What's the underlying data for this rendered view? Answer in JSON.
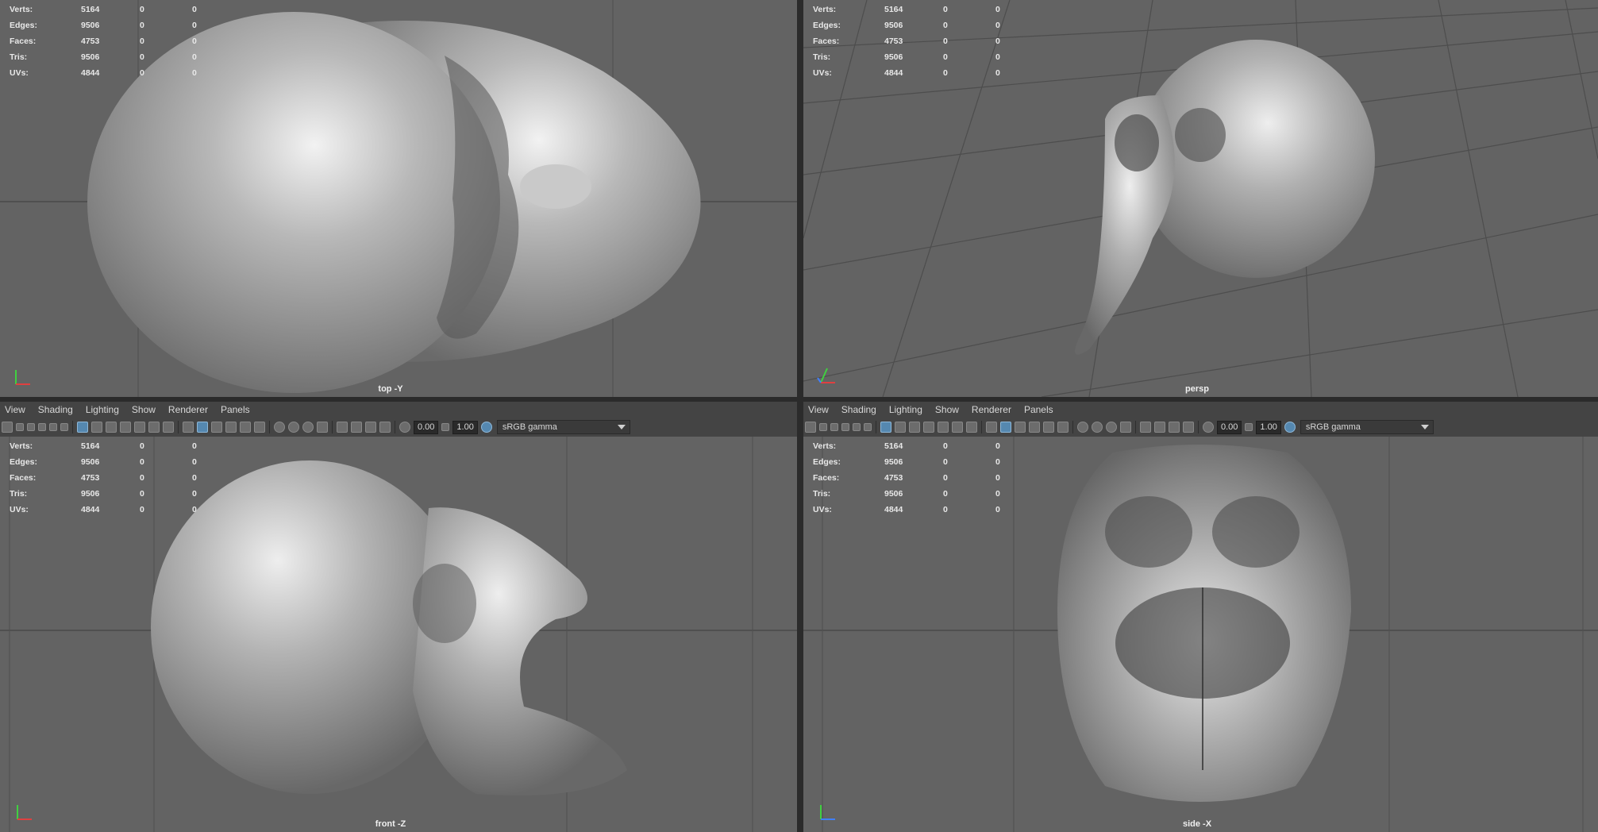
{
  "stats": [
    {
      "label": "Verts:",
      "v1": "5164",
      "v2": "0",
      "v3": "0"
    },
    {
      "label": "Edges:",
      "v1": "9506",
      "v2": "0",
      "v3": "0"
    },
    {
      "label": "Faces:",
      "v1": "4753",
      "v2": "0",
      "v3": "0"
    },
    {
      "label": "Tris:",
      "v1": "9506",
      "v2": "0",
      "v3": "0"
    },
    {
      "label": "UVs:",
      "v1": "4844",
      "v2": "0",
      "v3": "0"
    }
  ],
  "panels": {
    "top": {
      "camera": "top -Y"
    },
    "persp": {
      "camera": "persp"
    },
    "front": {
      "camera": "front -Z"
    },
    "side": {
      "camera": "side -X"
    }
  },
  "menu": [
    "View",
    "Shading",
    "Lighting",
    "Show",
    "Renderer",
    "Panels"
  ],
  "toolbar": {
    "near_value": "0.00",
    "far_value": "1.00",
    "color_space": "sRGB gamma"
  },
  "colors": {
    "viewport_bg": "#636363",
    "grid": "#4a4a4a",
    "axis_x": "#e04040",
    "axis_y": "#40d040",
    "axis_z": "#4080ff"
  },
  "icons": [
    "camera-icon",
    "grid-icon",
    "wireframe-icon",
    "smooth-shade-icon",
    "light-icon",
    "xray-icon",
    "isolate-icon",
    "color-management-icon"
  ]
}
